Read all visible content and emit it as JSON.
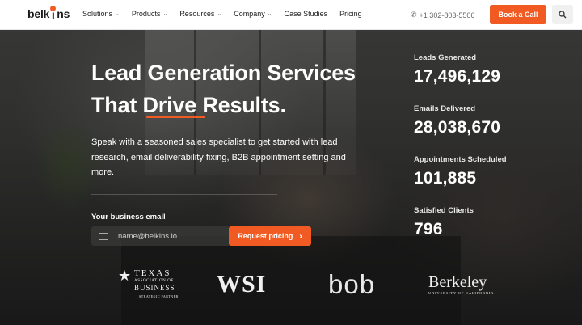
{
  "brand": {
    "logo_text_a": "belk",
    "logo_text_b": "ns"
  },
  "nav": {
    "items": [
      {
        "label": "Solutions",
        "dropdown": true
      },
      {
        "label": "Products",
        "dropdown": true
      },
      {
        "label": "Resources",
        "dropdown": true
      },
      {
        "label": "Company",
        "dropdown": true
      },
      {
        "label": "Case Studies",
        "dropdown": false
      },
      {
        "label": "Pricing",
        "dropdown": false
      }
    ],
    "phone": "+1 302-803-5506",
    "cta_label": "Book a Call",
    "search_icon": "search-icon"
  },
  "hero": {
    "title_line1": "Lead Generation Services",
    "title_line2": "That Drive Results.",
    "subtitle": "Speak with a seasoned sales specialist to get started with lead research, email deliverability fixing, B2B appointment setting and more.",
    "email_label": "Your business email",
    "email_placeholder": "name@belkins.io",
    "button_label": "Request pricing"
  },
  "stats": [
    {
      "label": "Leads Generated",
      "value": "17,496,129"
    },
    {
      "label": "Emails Delivered",
      "value": "28,038,670"
    },
    {
      "label": "Appointments Scheduled",
      "value": "101,885"
    },
    {
      "label": "Satisfied Clients",
      "value": "796"
    }
  ],
  "logos": {
    "texas": {
      "line1": "TEXAS",
      "line2": "ASSOCIATION OF",
      "line3": "BUSINESS",
      "line4": "STRATEGIC PARTNER"
    },
    "wsi": "WSI",
    "bob": "bob",
    "berkeley": {
      "line1": "Berkeley",
      "line2": "UNIVERSITY OF CALIFORNIA"
    }
  },
  "colors": {
    "accent": "#f15a22",
    "nav_text": "#222222",
    "hero_text": "#ffffff"
  }
}
